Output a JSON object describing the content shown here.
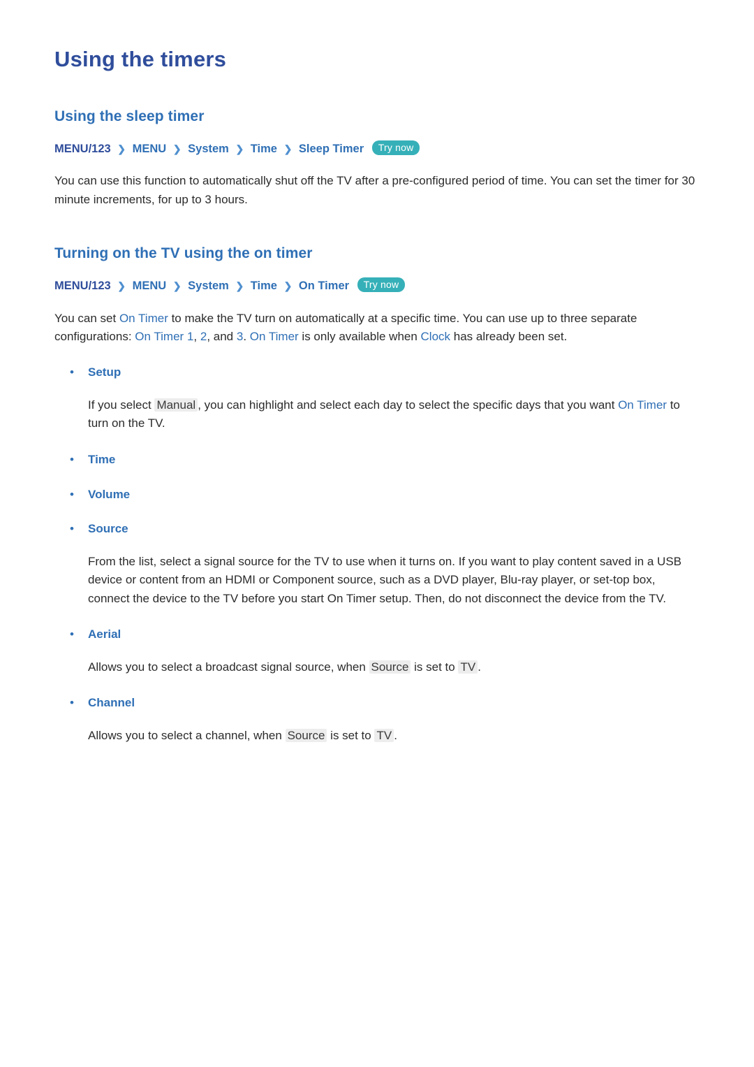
{
  "page": {
    "title": "Using the timers",
    "sections": [
      {
        "heading": "Using the sleep timer",
        "breadcrumb": {
          "items": [
            "MENU/123",
            "MENU",
            "System",
            "Time",
            "Sleep Timer"
          ],
          "arrow": "❯",
          "try_now": "Try now"
        },
        "paragraph": "You can use this function to automatically shut off the TV after a pre-configured period of time. You can set the timer for 30 minute increments, for up to 3 hours."
      },
      {
        "heading": "Turning on the TV using the on timer",
        "breadcrumb": {
          "items": [
            "MENU/123",
            "MENU",
            "System",
            "Time",
            "On Timer"
          ],
          "arrow": "❯",
          "try_now": "Try now"
        }
      }
    ],
    "intro": {
      "t1": "You can set ",
      "k1": "On Timer",
      "t2": " to make the TV turn on automatically at a specific time. You can use up to three separate configurations: ",
      "k2": "On Timer",
      "k3": "1",
      "t3": ", ",
      "k4": "2",
      "t4": ", and ",
      "k5": "3",
      "t5": ". ",
      "k6": "On Timer",
      "t6": " is only available when ",
      "k7": "Clock",
      "t7": " has already been set."
    },
    "bullets": [
      {
        "dot": "•",
        "label": "Setup",
        "body": {
          "t1": "If you select ",
          "k1": "Manual",
          "t2": ", you can highlight and select each day to select the specific days that you want ",
          "k2": "On Timer",
          "t3": " to turn on the TV."
        }
      },
      {
        "dot": "•",
        "label": "Time",
        "body": null
      },
      {
        "dot": "•",
        "label": "Volume",
        "body": null
      },
      {
        "dot": "•",
        "label": "Source",
        "body": {
          "t1": "From the list, select a signal source for the TV to use when it turns on. If you want to play content saved in a USB device or content from an HDMI or Component source, such as a DVD player, Blu-ray player, or set-top box, connect the device to the TV before you start On Timer setup. Then, do not disconnect the device from the TV."
        }
      },
      {
        "dot": "•",
        "label": "Aerial",
        "body": {
          "t1": "Allows you to select a broadcast signal source, when ",
          "k1": "Source",
          "t2": " is set to ",
          "k2": "TV",
          "t3": "."
        }
      },
      {
        "dot": "•",
        "label": "Channel",
        "body": {
          "t1": "Allows you to select a channel, when ",
          "k1": "Source",
          "t2": " is set to ",
          "k2": "TV",
          "t3": "."
        }
      }
    ],
    "colors": {
      "title": "#2f4d9b",
      "heading": "#2f6fb5",
      "keyword": "#2f6fb5",
      "try_now_bg": "#36b0b8",
      "body": "#2b2b2b"
    }
  }
}
